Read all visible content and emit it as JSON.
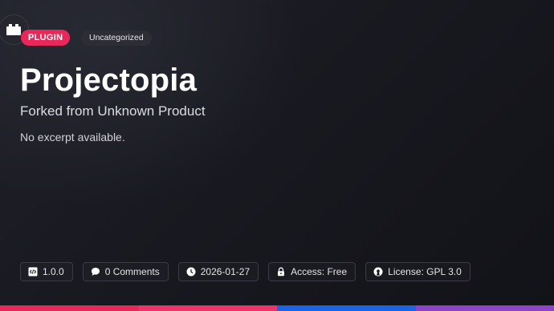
{
  "badges": {
    "type_label": "PLUGIN",
    "category_label": "Uncategorized"
  },
  "product": {
    "title": "Projectopia",
    "subtitle": "Forked from Unknown Product",
    "excerpt": "No excerpt available."
  },
  "meta": {
    "version": "1.0.0",
    "comments": "0 Comments",
    "date": "2026-01-27",
    "access": "Access: Free",
    "license": "License: GPL 3.0"
  },
  "icons": {
    "product": "plugin-box-icon",
    "version": "code-file-icon",
    "comments": "chat-bubble-icon",
    "date": "clock-icon",
    "access": "lock-icon",
    "license": "open-source-icon"
  },
  "colors": {
    "background": "#15161c",
    "plugin_badge": "#e8275a",
    "category_badge": "#2c2d35",
    "bar_segments": [
      "#e8275a",
      "#f0336a",
      "#1a64e6",
      "#8e44c8"
    ]
  }
}
